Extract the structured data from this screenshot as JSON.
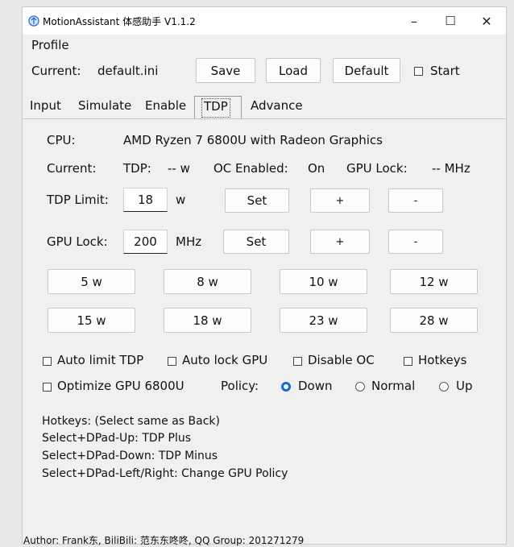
{
  "window": {
    "title": "MotionAssistant 体感助手 V1.1.2",
    "controls": {
      "minimize": "–",
      "maximize": "☐",
      "close": "✕"
    }
  },
  "profile": {
    "group_label": "Profile",
    "current_label": "Current:",
    "current_value": "default.ini",
    "save_label": "Save",
    "load_label": "Load",
    "default_label": "Default",
    "start_label": "Start",
    "start_checked": false
  },
  "tabs": [
    {
      "label": "Input",
      "active": false
    },
    {
      "label": "Simulate",
      "active": false
    },
    {
      "label": "Enable",
      "active": false
    },
    {
      "label": "TDP",
      "active": true
    },
    {
      "label": "Advance",
      "active": false
    }
  ],
  "tdp": {
    "cpu_label": "CPU:",
    "cpu_value": "AMD Ryzen 7 6800U with Radeon Graphics",
    "current_label": "Current:",
    "tdp_label": "TDP:",
    "tdp_value": "-- w",
    "oc_label": "OC Enabled:",
    "oc_value": "On",
    "gpu_lock_label": "GPU Lock:",
    "gpu_lock_value": "-- MHz",
    "tdp_limit_label": "TDP Limit:",
    "tdp_limit_value": "18",
    "tdp_limit_unit": "w",
    "gpu_lock_set_label": "GPU Lock:",
    "gpu_lock_set_value": "200",
    "gpu_lock_unit": "MHz",
    "set_label": "Set",
    "plus_label": "+",
    "minus_label": "-",
    "presets": [
      "5 w",
      "8 w",
      "10 w",
      "12 w",
      "15 w",
      "18 w",
      "23 w",
      "28 w"
    ],
    "options": {
      "auto_limit_tdp": "Auto limit TDP",
      "auto_lock_gpu": "Auto lock GPU",
      "disable_oc": "Disable OC",
      "hotkeys": "Hotkeys",
      "optimize_gpu": "Optimize GPU 6800U"
    },
    "policy_label": "Policy:",
    "policy_options": [
      "Down",
      "Normal",
      "Up"
    ],
    "policy_selected": "Down",
    "hotkeys_help": [
      "Hotkeys: (Select same as Back)",
      "Select+DPad-Up: TDP Plus",
      "Select+DPad-Down: TDP Minus",
      "Select+DPad-Left/Right: Change GPU Policy"
    ]
  },
  "footer": {
    "text": "Author: Frank东, BiliBili: 范东东咚咚, QQ Group: 201271279"
  },
  "colors": {
    "accent": "#1a66d2",
    "window_bg": "#f0f0f0",
    "titlebar_bg": "#ffffff"
  }
}
